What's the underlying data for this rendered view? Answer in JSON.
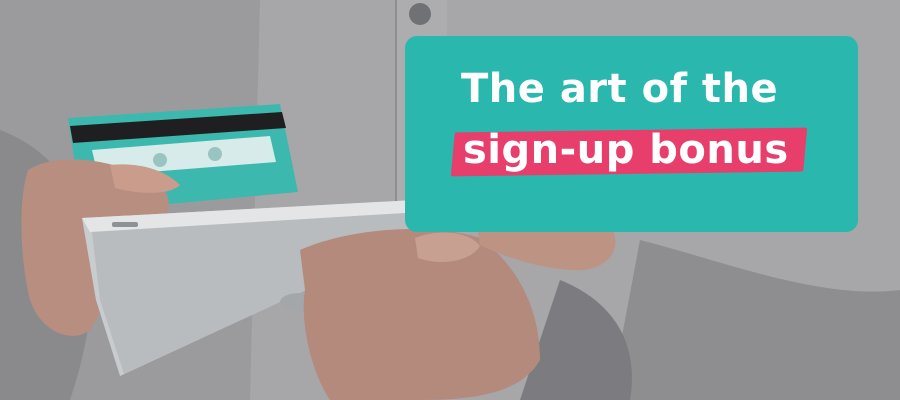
{
  "banner": {
    "headline_line1": "The art of the",
    "headline_line2": "sign-up bonus",
    "card_color": "#2ab7ae",
    "highlight_color": "#e83e6c",
    "text_color": "#ffffff"
  },
  "photo": {
    "subject": "person holding a credit card and a tablet",
    "icons": [
      "credit-card-icon",
      "tablet-icon"
    ]
  }
}
